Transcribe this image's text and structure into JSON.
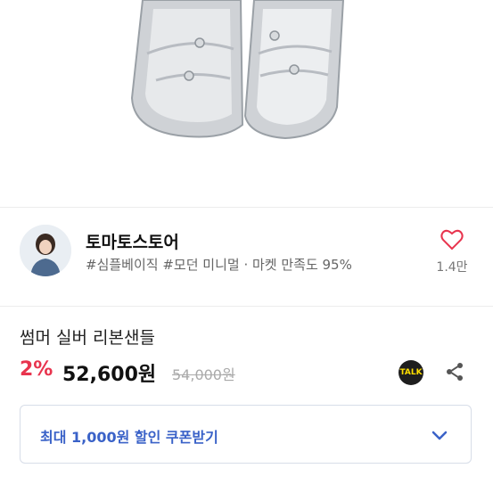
{
  "store": {
    "name": "토마토스토어",
    "tags": "#심플베이직 #모던 미니멀 · 마켓 만족도 95%",
    "likes": "1.4만"
  },
  "product": {
    "title": "썸머 실버 리본샌들",
    "discount": "2%",
    "price": "52,600원",
    "original_price": "54,000원"
  },
  "actions": {
    "talk_label": "TALK"
  },
  "coupon": {
    "label": "최대 1,000원 할인 쿠폰받기"
  },
  "colors": {
    "discount": "#e8344e",
    "coupon_text": "#3a62c8",
    "heart": "#e8344e"
  }
}
